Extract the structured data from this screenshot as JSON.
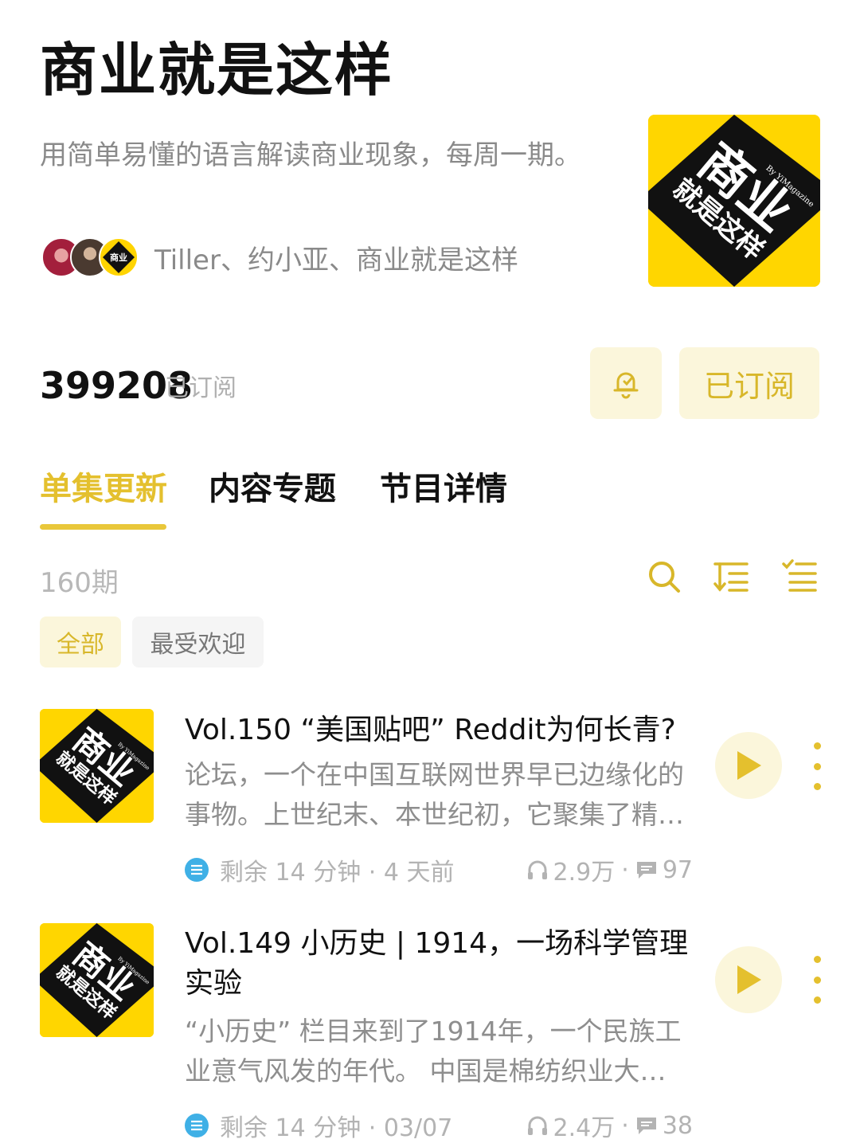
{
  "podcast": {
    "title": "商业就是这样",
    "description": "用简单易懂的语言解读商业现象，每周一期。",
    "hosts": "Tiller、约小亚、商业就是这样",
    "cover_text_top": "商业",
    "cover_text_bottom": "就是这样",
    "cover_by": "By YiMagazine"
  },
  "subscription": {
    "count": "399208",
    "label": "已订阅",
    "button_label": "已订阅"
  },
  "tabs": [
    {
      "label": "单集更新",
      "active": true
    },
    {
      "label": "内容专题",
      "active": false
    },
    {
      "label": "节目详情",
      "active": false
    }
  ],
  "episode_list": {
    "count": "160期",
    "filters": [
      "全部",
      "最受欢迎"
    ]
  },
  "episodes": [
    {
      "title": "Vol.150 “美国贴吧” Reddit为何长青?",
      "summary": "论坛，一个在中国互联网世界早已边缘化的事物。上世纪末、本世纪初，它聚集了精…",
      "remaining": "剩余 14 分钟 · 4 天前",
      "plays": "2.9万",
      "comments": "97"
    },
    {
      "title": "Vol.149 小历史 | 1914，一场科学管理实验",
      "summary": "“小历史” 栏目来到了1914年，一个民族工业意气风发的年代。 中国是棉纺织业大…",
      "remaining": "剩余 14 分钟 · 03/07",
      "plays": "2.4万",
      "comments": "38"
    }
  ],
  "colors": {
    "accent": "#e4c02e",
    "accent_bg": "#fbf6db",
    "cover_yellow": "#ffd600",
    "progress_icon": "#3fb0e6"
  }
}
